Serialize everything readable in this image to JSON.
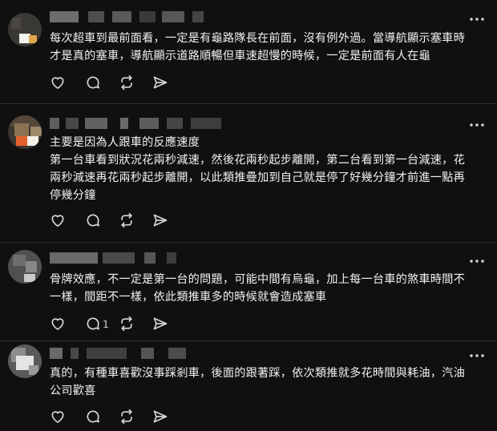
{
  "posts": [
    {
      "text_lines": [
        "每次超車到最前面看，一定是有龜路隊長在前面，沒有例外過。當導航顯示塞車時",
        "才是真的塞車，導航顯示道路順暢但車速超慢的時候，一定是前面有人在龜"
      ],
      "reply_count": ""
    },
    {
      "text_lines": [
        "主要是因為人跟車的反應速度",
        "第一台車看到狀況花兩秒減速，然後花兩秒起步離開，第二台看到第一台減速，花",
        "兩秒減速再花兩秒起步離開，以此類推疊加到自己就是停了好幾分鐘才前進一點再",
        "停幾分鐘"
      ],
      "reply_count": ""
    },
    {
      "text_lines": [
        "骨牌效應，不一定是第一台的問題，可能中間有烏龜，加上每一台車的煞車時間不",
        "一樣，間距不一樣，依此類推車多的時候就會造成塞車"
      ],
      "reply_count": "1"
    },
    {
      "text_lines": [
        "真的，有種車喜歡沒事踩剎車，後面的跟著踩，依次類推就多花時間與耗油，汽油",
        "公司歡喜"
      ],
      "reply_count": ""
    }
  ],
  "icons": {
    "like": "heart-icon",
    "reply": "speech-bubble-icon",
    "repost": "repost-arrows-icon",
    "share": "paper-plane-icon",
    "more": "more-horizontal-icon"
  },
  "colors": {
    "background": "#101010",
    "text": "#f3f5f7",
    "icon": "#d8d8d8",
    "divider": "#2d2d2d"
  }
}
